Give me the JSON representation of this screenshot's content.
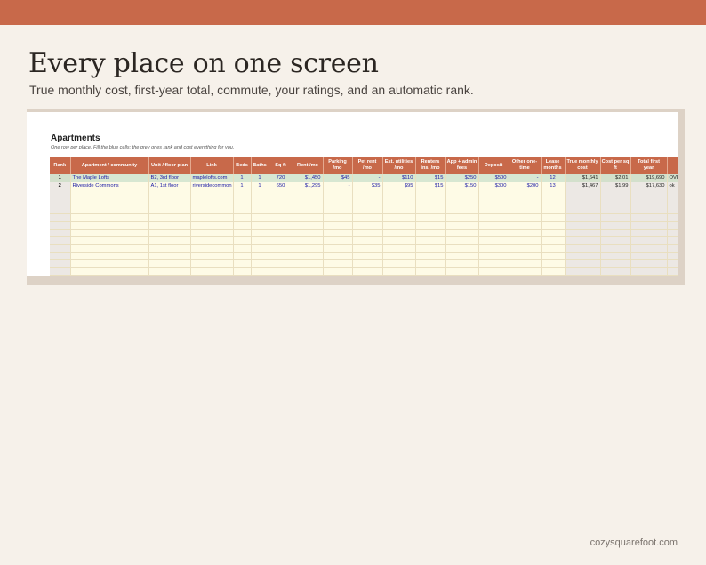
{
  "headline": "Every place on one screen",
  "subline": "True monthly cost, first-year total, commute, your ratings, and an automatic rank.",
  "sheet": {
    "title": "Apartments",
    "note": "One row per place. Fill the blue cells; the grey ones rank and cost everything for you.",
    "columns": [
      "Rank",
      "Apartment / community",
      "Unit / floor plan",
      "Link",
      "Beds",
      "Baths",
      "Sq ft",
      "Rent /mo",
      "Parking /mo",
      "Pet rent /mo",
      "Est. utilities /mo",
      "Renters ins. /mo",
      "App + admin fees",
      "Deposit",
      "Other one-time",
      "Lease months",
      "True monthly cost",
      "Cost per sq ft",
      "Total first year",
      "In bu"
    ],
    "rows": [
      [
        "1",
        "The Maple Lofts",
        "B2, 3rd floor",
        "maplelofts.com",
        "1",
        "1",
        "720",
        "$1,450",
        "$45",
        "-",
        "$110",
        "$15",
        "$250",
        "$500",
        "-",
        "12",
        "$1,641",
        "$2.01",
        "$19,690",
        "OVE"
      ],
      [
        "2",
        "Riverside Commons",
        "A1, 1st floor",
        "riversidecommon",
        "1",
        "1",
        "650",
        "$1,295",
        "-",
        "$35",
        "$95",
        "$15",
        "$150",
        "$300",
        "$200",
        "13",
        "$1,467",
        "$1.99",
        "$17,630",
        "ok"
      ]
    ]
  },
  "footer": "cozysquarefoot.com",
  "colors": {
    "accent": "#c8694a",
    "background": "#f6f1ea",
    "input_fill": "#fefbe6",
    "input_text": "#1a1aa6",
    "computed_fill": "#ece8e4"
  }
}
